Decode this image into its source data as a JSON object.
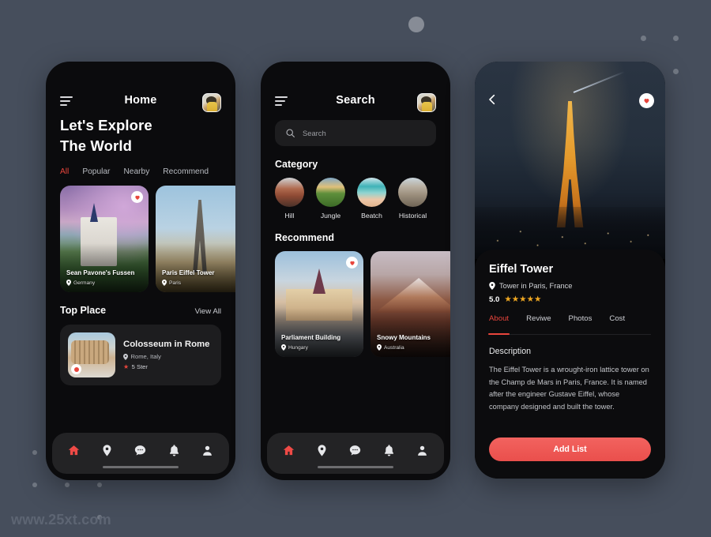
{
  "watermark": "www.25xt.com",
  "colors": {
    "background": "#464e5c",
    "phone_body": "#0b0b0d",
    "accent_red": "#e8453c",
    "accent_button": "#ea4f4c",
    "star_gold": "#f0a822",
    "card_surface": "#1d1d1f",
    "nav_surface": "#232325"
  },
  "phone_home": {
    "title": "Home",
    "menu_icon": "hamburger-icon",
    "avatar_icon": "user-avatar",
    "headline_line1": "Let's Explore",
    "headline_line2": "The World",
    "tabs": [
      {
        "label": "All",
        "active": true
      },
      {
        "label": "Popular",
        "active": false
      },
      {
        "label": "Nearby",
        "active": false
      },
      {
        "label": "Recommend",
        "active": false
      }
    ],
    "cards": [
      {
        "title": "Sean Pavone's Fussen",
        "location": "Germany",
        "favorite": true
      },
      {
        "title": "Paris Eiffel Tower",
        "location": "Paris",
        "favorite": false
      }
    ],
    "section": {
      "title": "Top Place",
      "action": "View All"
    },
    "top_place": {
      "name": "Colosseum in Rome",
      "location": "Rome, Italy",
      "rating": "5 Ster"
    },
    "nav": [
      {
        "name": "home",
        "active": true
      },
      {
        "name": "location",
        "active": false
      },
      {
        "name": "chat",
        "active": false
      },
      {
        "name": "notifications",
        "active": false
      },
      {
        "name": "profile",
        "active": false
      }
    ]
  },
  "phone_search": {
    "title": "Search",
    "search_placeholder": "Search",
    "search_value": "",
    "category_title": "Category",
    "categories": [
      {
        "label": "Hill"
      },
      {
        "label": "Jungle"
      },
      {
        "label": "Beatch"
      },
      {
        "label": "Historical"
      }
    ],
    "recommend_title": "Recommend",
    "recommend_cards": [
      {
        "title": "Parliament Building",
        "location": "Hungary",
        "favorite": true
      },
      {
        "title": "Snowy Mountains",
        "location": "Australia",
        "favorite": false
      }
    ],
    "nav": [
      {
        "name": "home",
        "active": true
      },
      {
        "name": "location",
        "active": false
      },
      {
        "name": "chat",
        "active": false
      },
      {
        "name": "notifications",
        "active": false
      },
      {
        "name": "profile",
        "active": false
      }
    ]
  },
  "phone_detail": {
    "back_icon": "chevron-left-icon",
    "favorite_icon": "heart-icon",
    "title": "Eiffel Tower",
    "location": "Tower in Paris, France",
    "rating_value": "5.0",
    "stars": "★★★★★",
    "tabs": [
      {
        "label": "About",
        "active": true
      },
      {
        "label": "Reviwe",
        "active": false
      },
      {
        "label": "Photos",
        "active": false
      },
      {
        "label": "Cost",
        "active": false
      }
    ],
    "description_title": "Description",
    "description_body": "The Eiffel Tower is a wrought-iron lattice tower on the Champ de Mars in Paris, France. It is named after the engineer Gustave Eiffel, whose company designed and built the tower.",
    "cta_label": "Add List"
  }
}
